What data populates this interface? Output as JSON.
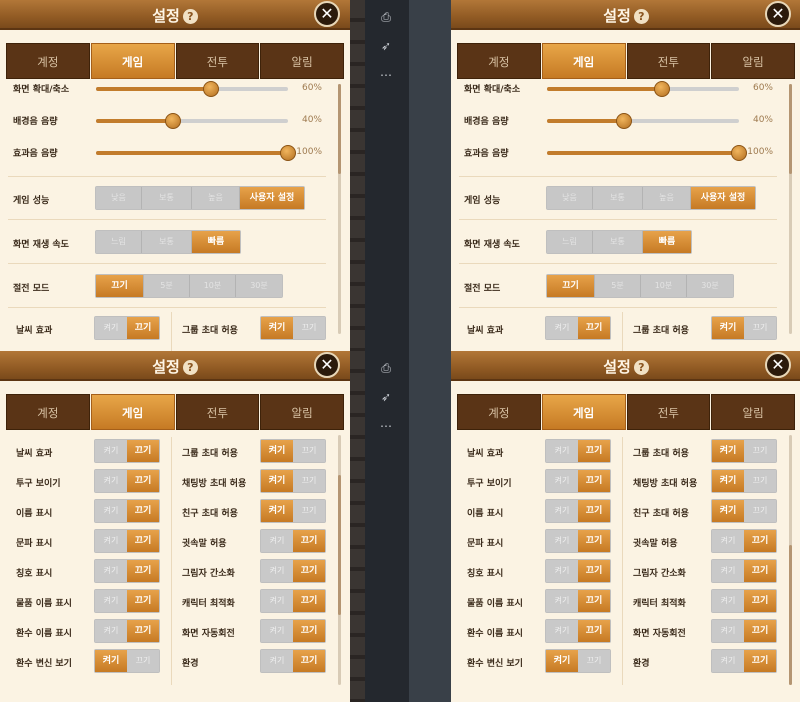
{
  "dialog": {
    "title": "설정",
    "help_glyph": "?",
    "close_glyph": "✕"
  },
  "tabs": [
    "계정",
    "게임",
    "전투",
    "알림"
  ],
  "active_tab": 1,
  "sliders": [
    {
      "label": "화면 확대/축소",
      "value": 60,
      "text": "60%"
    },
    {
      "label": "배경음 음량",
      "value": 40,
      "text": "40%"
    },
    {
      "label": "효과음 음량",
      "value": 100,
      "text": "100%"
    }
  ],
  "groups": [
    {
      "label": "게임 성능",
      "options": [
        "낮음",
        "보통",
        "높음",
        "사용자 설정"
      ],
      "selected": 3
    },
    {
      "label": "화면 재생 속도",
      "options": [
        "느림",
        "보통",
        "빠름"
      ],
      "selected": 2
    },
    {
      "label": "절전 모드",
      "options": [
        "끄기",
        "5분",
        "10분",
        "30분"
      ],
      "selected": 0
    }
  ],
  "toggle_on_label": "켜기",
  "toggle_off_label": "끄기",
  "toggles_left": [
    {
      "label": "날씨 효과",
      "on": false
    },
    {
      "label": "투구 보이기",
      "on": false
    },
    {
      "label": "이름 표시",
      "on": false
    },
    {
      "label": "문파 표시",
      "on": false
    },
    {
      "label": "칭호 표시",
      "on": false
    },
    {
      "label": "물품 이름 표시",
      "on": false
    },
    {
      "label": "환수 이름 표시",
      "on": false
    },
    {
      "label": "환수 변신 보기",
      "on": true
    }
  ],
  "toggles_right": [
    {
      "label": "그룹 초대 허용",
      "on": true
    },
    {
      "label": "채팅방 초대 허용",
      "on": true
    },
    {
      "label": "친구 초대 허용",
      "on": true
    },
    {
      "label": "귓속말 허용",
      "on": false
    },
    {
      "label": "그림자 간소화",
      "on": false
    },
    {
      "label": "캐릭터 최적화",
      "on": false
    },
    {
      "label": "화면 자동회전",
      "on": false
    },
    {
      "label": "환경",
      "on": false
    }
  ],
  "side_rail": {
    "icons": [
      "print-icon",
      "rocket-icon",
      "more-icon"
    ],
    "glyphs": [
      "⎙",
      "🚀",
      "⋯"
    ]
  },
  "colors": {
    "accent": "#c67a24",
    "header": "#915b24",
    "panel": "#fbf3e3",
    "tab_dark": "#5a3416"
  }
}
